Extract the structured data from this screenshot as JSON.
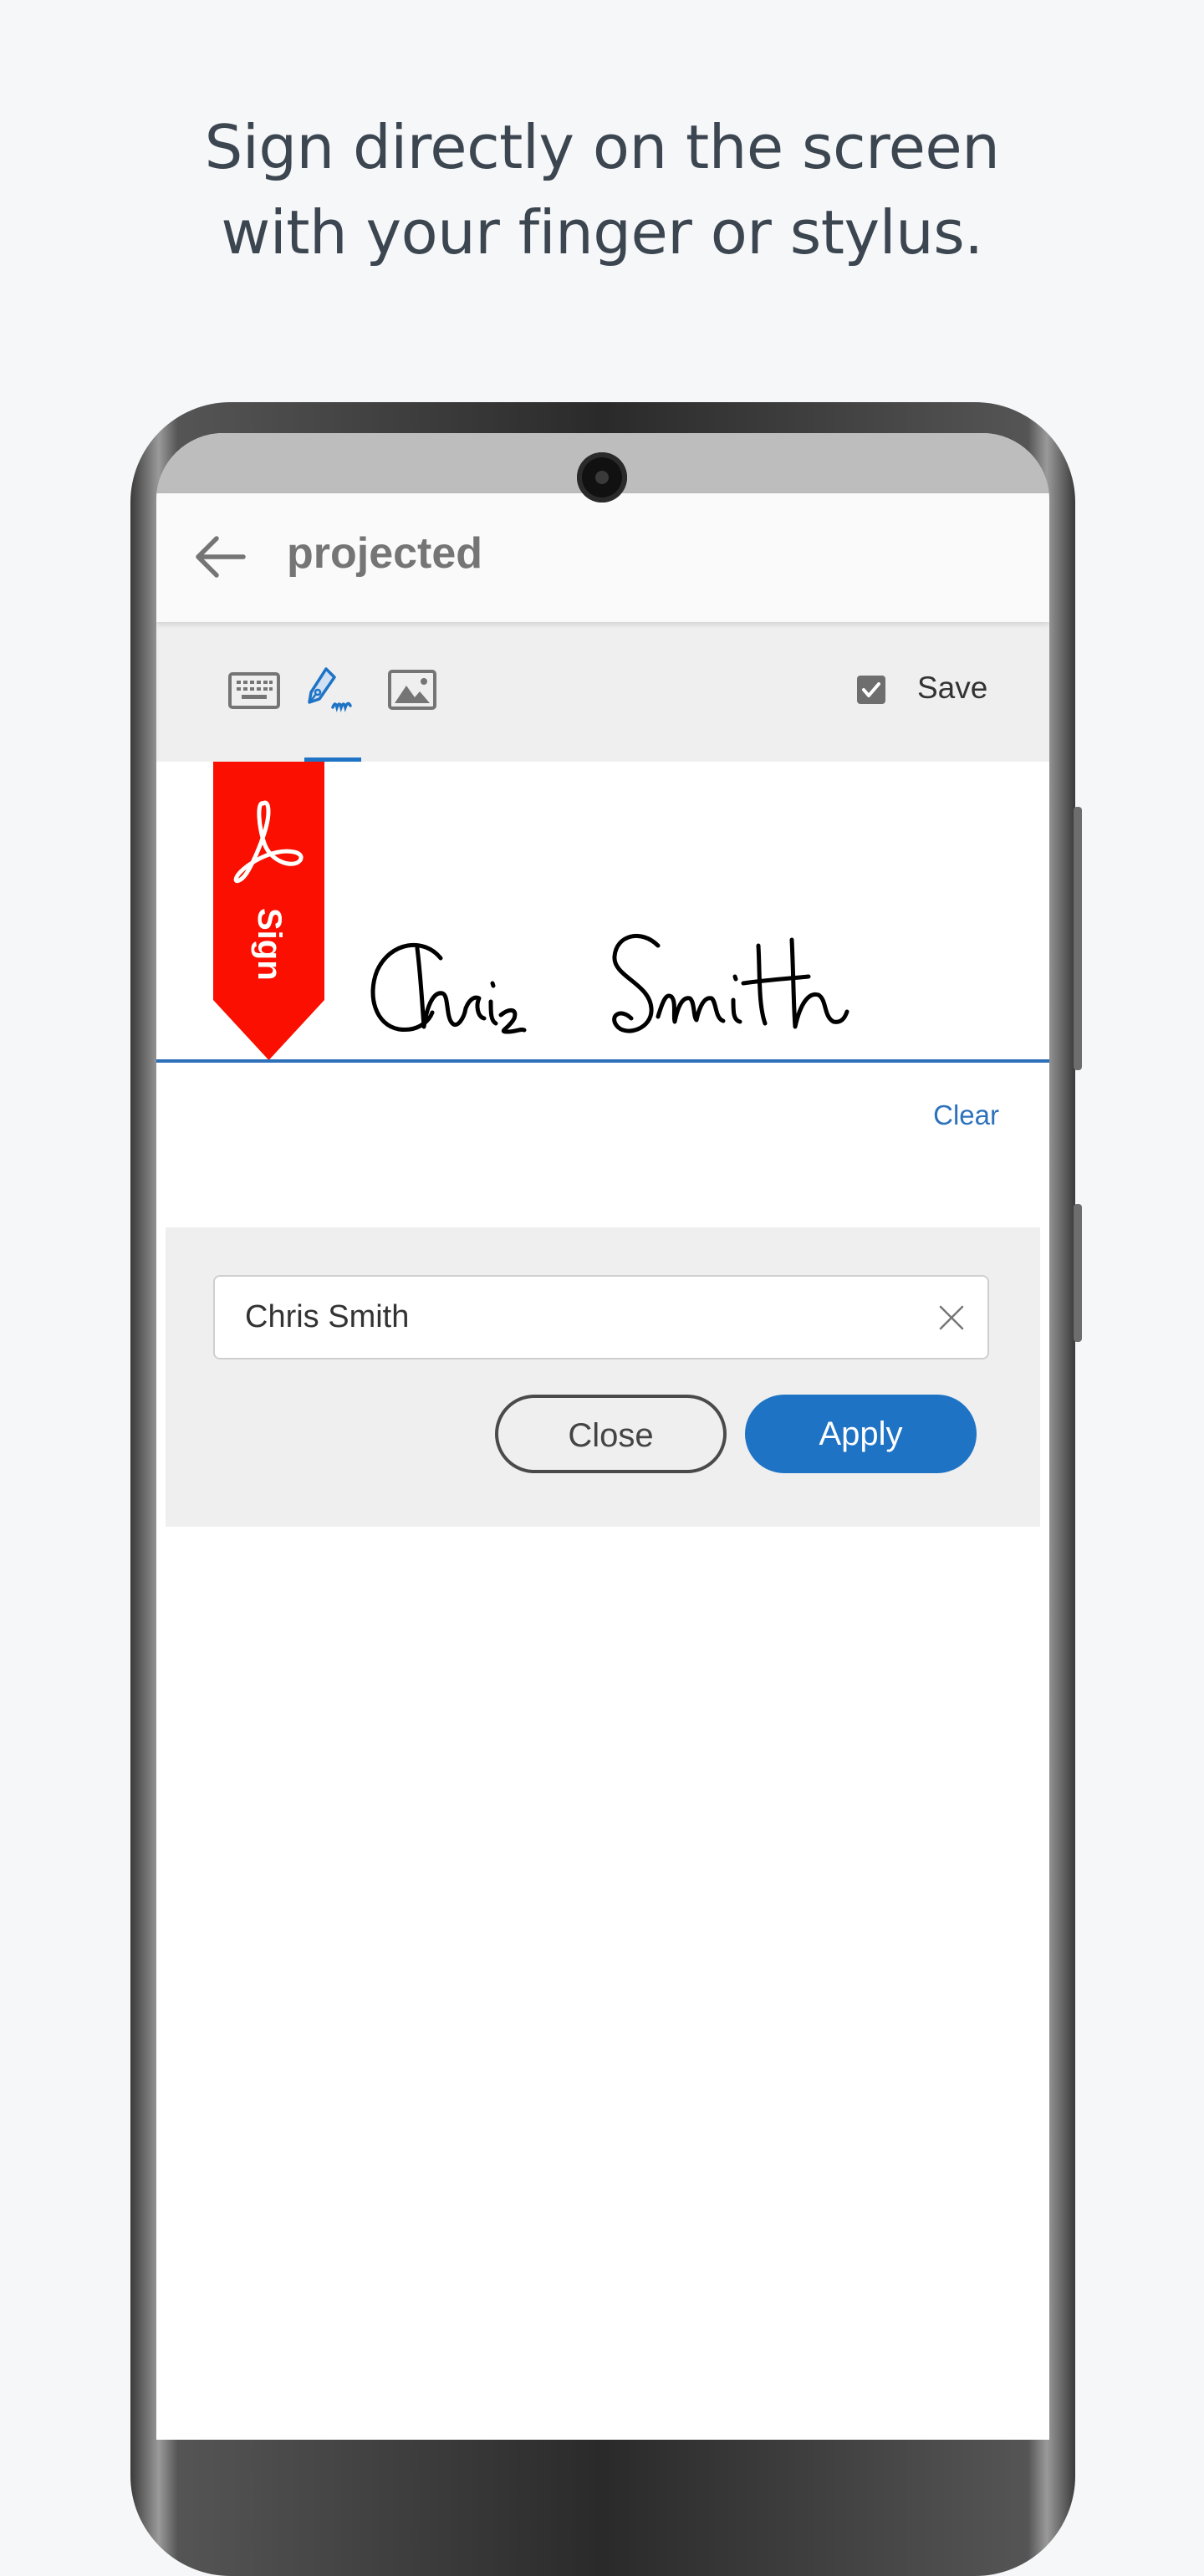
{
  "headline": {
    "line1": "Sign directly on the screen",
    "line2": "with your finger or stylus."
  },
  "appbar": {
    "back_icon": "arrow-left-icon",
    "title": "projected"
  },
  "toolbar": {
    "modes": [
      {
        "name": "keyboard-icon",
        "selected": false
      },
      {
        "name": "pen-signature-icon",
        "selected": true
      },
      {
        "name": "image-icon",
        "selected": false
      }
    ],
    "save_checked": true,
    "save_label": "Save"
  },
  "signature": {
    "ribbon_label": "Sign",
    "ribbon_logo": "adobe-acrobat-logo",
    "drawn_text": "Chris Smith",
    "clear_label": "Clear"
  },
  "form": {
    "name_value": "Chris Smith",
    "close_label": "Close",
    "apply_label": "Apply"
  },
  "colors": {
    "accent": "#1f73c5",
    "ribbon": "#fa0f00",
    "headline": "#3c4650",
    "background": "#f6f7f9"
  }
}
